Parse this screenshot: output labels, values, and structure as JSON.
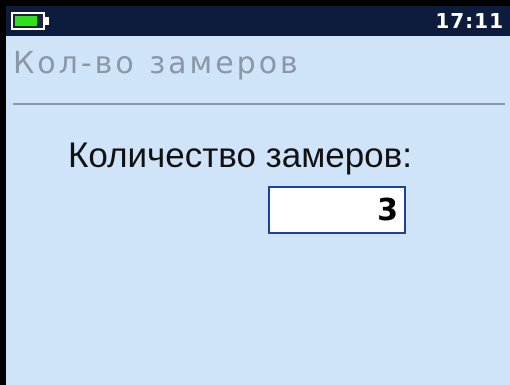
{
  "status_bar": {
    "time": "17:11",
    "battery_level_percent": 85,
    "battery_color": "#2ee11f"
  },
  "screen": {
    "title": "Кол-во замеров"
  },
  "measurements": {
    "label": "Количество замеров:",
    "value": "3"
  },
  "colors": {
    "status_bar_bg": "#0d1b3d",
    "screen_bg": "#cfe4f8",
    "title_text": "#8c97a6",
    "input_border": "#1f3fa6"
  }
}
